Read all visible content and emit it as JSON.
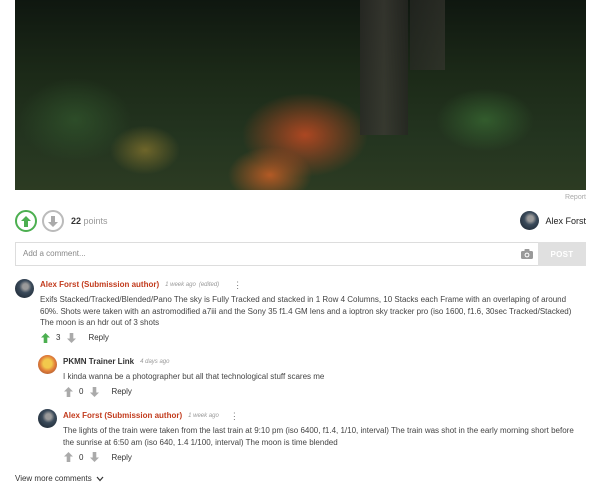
{
  "post": {
    "report_label": "Report",
    "points_count": "22",
    "points_label": "points",
    "author_name": "Alex Forst"
  },
  "comment_form": {
    "placeholder": "Add a comment...",
    "post_label": "POST"
  },
  "comments": [
    {
      "author": "Alex Forst (Submission author)",
      "time": "1 week ago",
      "edited": "(edited)",
      "body": "Exifs Stacked/Tracked/Blended/Pano The sky is Fully Tracked and stacked in 1 Row 4 Columns, 10 Stacks each Frame with an overlaping of around 60%. Shots were taken with an astromodified a7iii and the Sony 35 f1.4 GM lens and a ioptron sky tracker pro (iso 1600, f1.6, 30sec Tracked/Stacked) The moon is an hdr out of 3 shots",
      "votes": "3",
      "reply_label": "Reply"
    },
    {
      "author": "PKMN Trainer Link",
      "time": "4 days ago",
      "body": "I kinda wanna be a photographer but all that technological stuff scares me",
      "votes": "0",
      "reply_label": "Reply"
    },
    {
      "author": "Alex Forst (Submission author)",
      "time": "1 week ago",
      "body": "The lights of the train were taken from the last train at 9:10 pm (iso 6400, f1.4, 1/10, interval) The train was shot in the early morning short before the sunrise at 6:50 am (iso 640, 1.4 1/100, interval) The moon is time blended",
      "votes": "0",
      "reply_label": "Reply"
    }
  ],
  "view_more_label": "View more comments",
  "colors": {
    "upvote_active": "#4caf50",
    "author_accent": "#c23b1d",
    "post_button": "#e0e0e0"
  },
  "icons": [
    "upvote-icon",
    "downvote-icon",
    "camera-icon",
    "more-options-icon",
    "chevron-down-icon"
  ]
}
